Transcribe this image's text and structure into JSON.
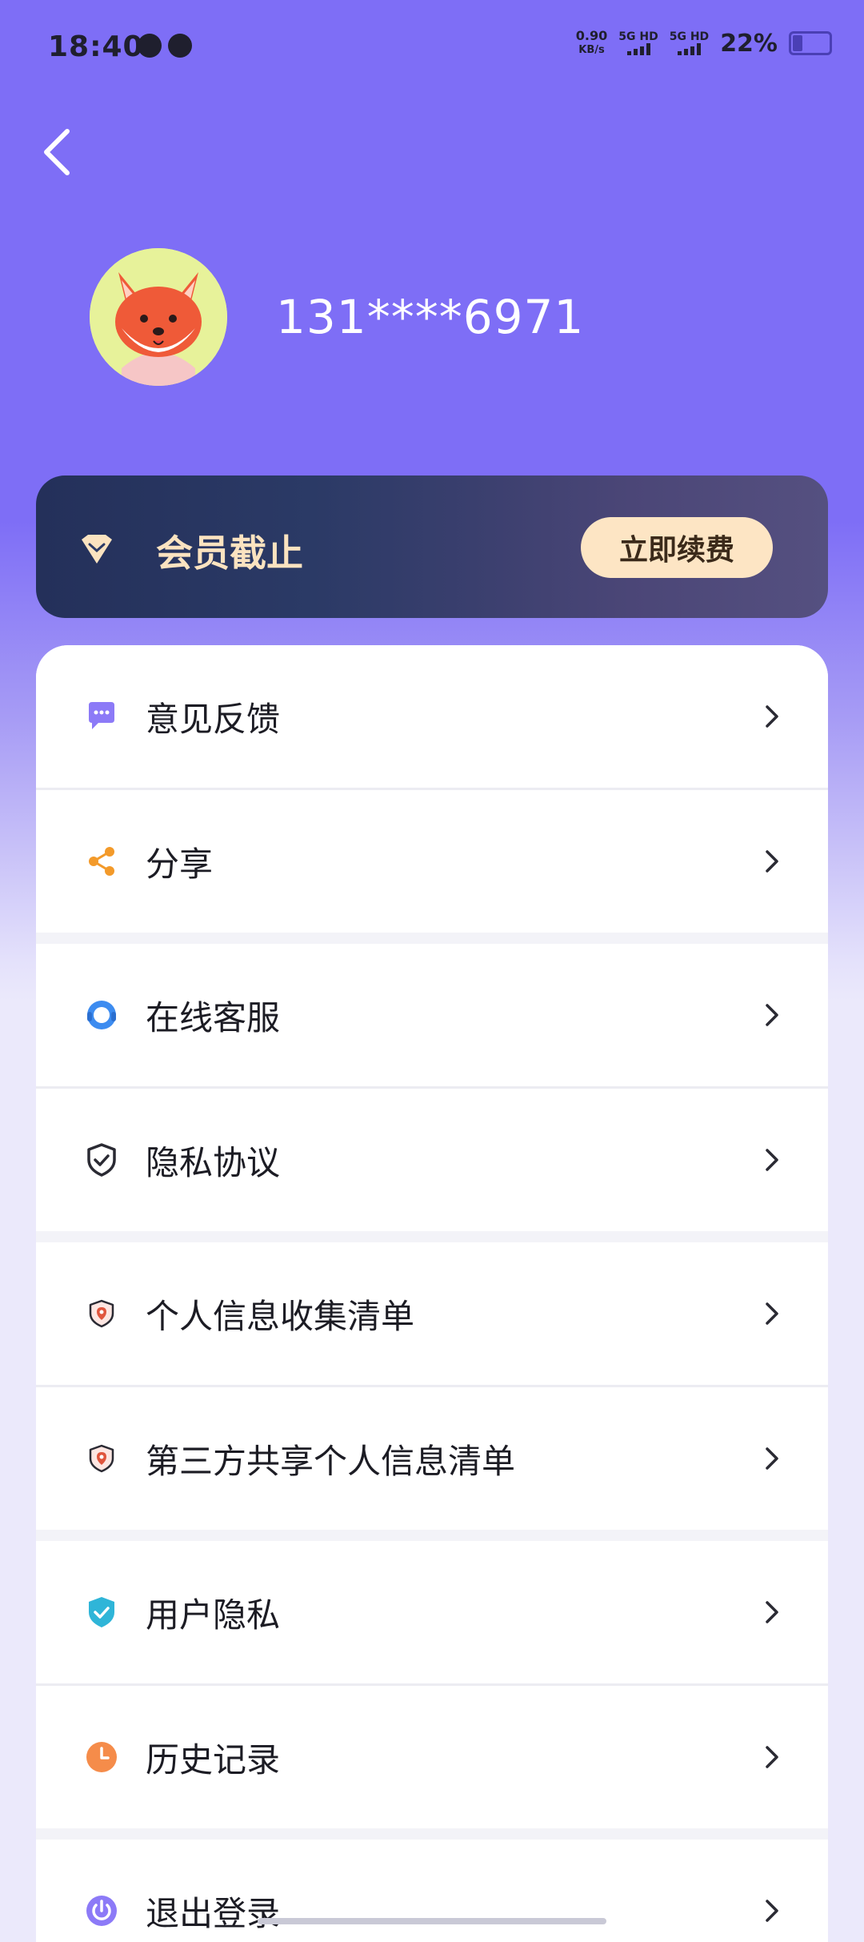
{
  "status_bar": {
    "time": "18:40",
    "speed": "0.90",
    "speed_unit": "KB/s",
    "sim1": "5G HD",
    "sim2": "5G HD",
    "battery": "22%"
  },
  "profile": {
    "phone": "131****6971"
  },
  "vip": {
    "label": "会员截止",
    "renew_button": "立即续费"
  },
  "menu": [
    {
      "label": "意见反馈",
      "icon": "chat-bubble-icon",
      "color": "#8c7af7"
    },
    {
      "label": "分享",
      "icon": "share-icon",
      "color": "#f39a2a"
    },
    {
      "label": "在线客服",
      "icon": "headset-icon",
      "color": "#3d8cf0"
    },
    {
      "label": "隐私协议",
      "icon": "shield-check-icon",
      "color": "#2a2a33"
    },
    {
      "label": "个人信息收集清单",
      "icon": "shield-pin-icon",
      "color": "#e0553d"
    },
    {
      "label": "第三方共享个人信息清单",
      "icon": "shield-pin-icon",
      "color": "#e0553d"
    },
    {
      "label": "用户隐私",
      "icon": "shield-check-filled-icon",
      "color": "#2fb5d8"
    },
    {
      "label": "历史记录",
      "icon": "clock-icon",
      "color": "#f58c4a"
    },
    {
      "label": "退出登录",
      "icon": "power-icon",
      "color": "#8c7af7"
    }
  ],
  "colors": {
    "header_bg": "#7e6ef6",
    "vip_text": "#fbe3c0",
    "renew_bg": "#fde5c4"
  }
}
